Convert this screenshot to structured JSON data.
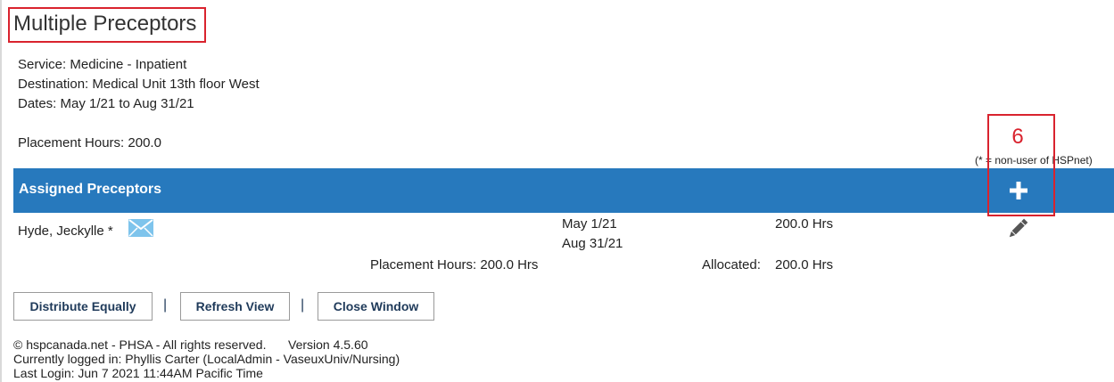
{
  "page": {
    "title": "Multiple Preceptors",
    "service": "Service: Medicine - Inpatient",
    "destination": "Destination: Medical Unit 13th floor West",
    "dates": "Dates: May 1/21  to  Aug 31/21",
    "placement_hours": "Placement Hours: 200.0"
  },
  "annotation": {
    "callout_number": "6",
    "highlight_color": "#d9232e"
  },
  "legend": {
    "note": "(* = non-user of HSPnet)"
  },
  "assigned_section": {
    "title": "Assigned Preceptors",
    "bar_color": "#2779bd",
    "add_icon": "plus-icon"
  },
  "preceptors": [
    {
      "name": "Hyde, Jeckylle *",
      "mail_icon": "envelope-icon",
      "start_date": "May 1/21",
      "end_date": "Aug 31/21",
      "hours": "200.0 Hrs",
      "edit_icon": "pencil-icon"
    }
  ],
  "totals": {
    "placement_hours": "Placement Hours: 200.0 Hrs",
    "allocated_label": "Allocated:",
    "allocated_value": "200.0 Hrs"
  },
  "actions": {
    "distribute": "Distribute Equally",
    "refresh": "Refresh View",
    "close": "Close Window",
    "separator": "|"
  },
  "footer": {
    "copyright": "© hspcanada.net - PHSA - All rights reserved.",
    "version": "Version 4.5.60",
    "logged_in": "Currently logged in: Phyllis Carter (LocalAdmin - VaseuxUniv/Nursing)",
    "last_login": "Last Login: Jun  7 2021 11:44AM Pacific Time"
  }
}
